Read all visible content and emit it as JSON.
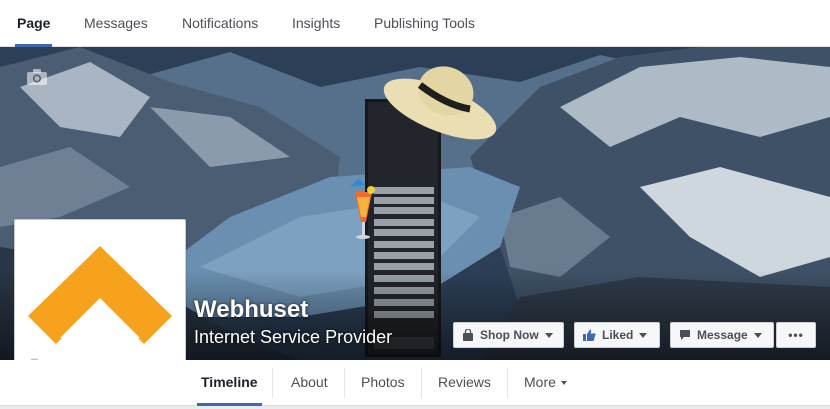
{
  "admin_tabs": [
    {
      "label": "Page",
      "active": true
    },
    {
      "label": "Messages",
      "active": false
    },
    {
      "label": "Notifications",
      "active": false
    },
    {
      "label": "Insights",
      "active": false
    },
    {
      "label": "Publishing Tools",
      "active": false
    }
  ],
  "page": {
    "name": "Webhuset",
    "category": "Internet Service Provider",
    "logo_color": "#f7a21c"
  },
  "cover_buttons": {
    "shop_now": "Shop Now",
    "liked": "Liked",
    "message": "Message",
    "more": "•••"
  },
  "page_nav": [
    {
      "label": "Timeline",
      "active": true
    },
    {
      "label": "About",
      "active": false
    },
    {
      "label": "Photos",
      "active": false
    },
    {
      "label": "Reviews",
      "active": false
    },
    {
      "label": "More",
      "active": false
    }
  ],
  "colors": {
    "accent": "#4267b2",
    "like_blue": "#4267b2"
  },
  "icons": [
    "camera-icon",
    "shopping-bag-icon",
    "thumbs-up-icon",
    "speech-bubble-icon",
    "caret-down-icon"
  ]
}
